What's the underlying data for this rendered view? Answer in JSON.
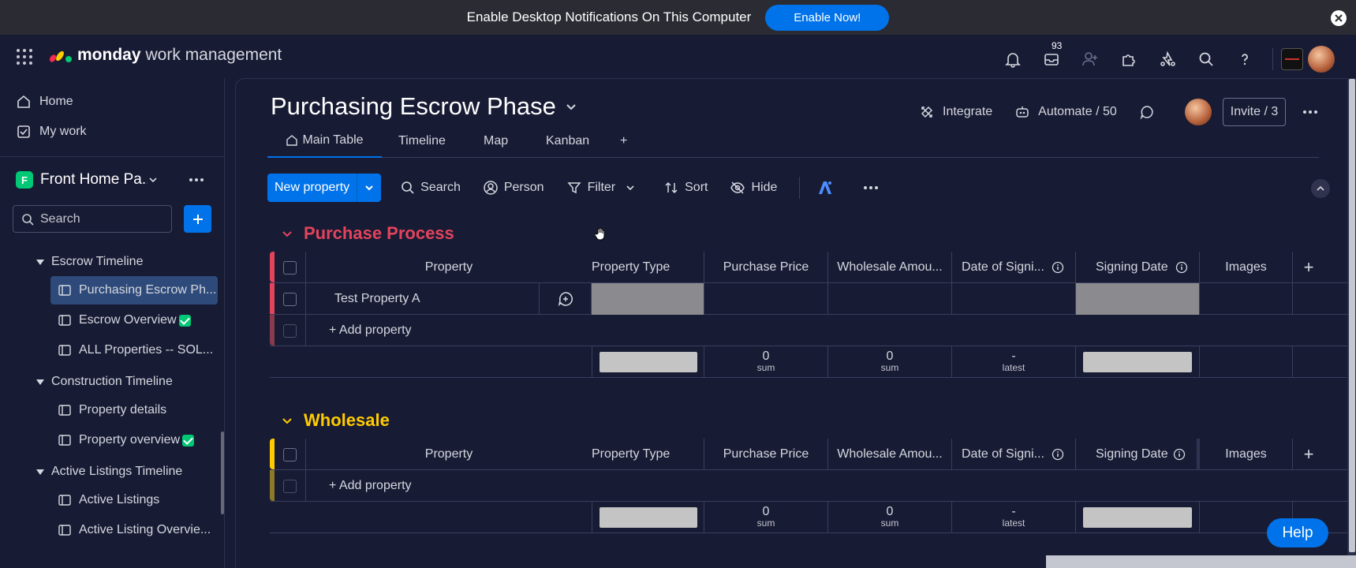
{
  "banner": {
    "text": "Enable Desktop Notifications On This Computer",
    "button": "Enable Now!"
  },
  "topbar": {
    "brand": "monday",
    "product": "work management",
    "inbox_count": "93"
  },
  "sidebar": {
    "home": "Home",
    "my_work": "My work",
    "workspace_initial": "F",
    "workspace_name": "Front Home Pa...",
    "search_placeholder": "Search",
    "folders": [
      {
        "name": "Escrow Timeline",
        "items": [
          "Purchasing Escrow Ph...",
          "Escrow Overview",
          "ALL Properties -- SOL..."
        ]
      },
      {
        "name": "Construction Timeline",
        "items": [
          "Property details",
          "Property overview"
        ]
      },
      {
        "name": "Active Listings Timeline",
        "items": [
          "Active Listings",
          "Active Listing Overvie..."
        ]
      }
    ]
  },
  "board": {
    "title": "Purchasing Escrow Phase",
    "integrate": "Integrate",
    "automate": "Automate / 50",
    "invite": "Invite / 3",
    "tabs": [
      "Main Table",
      "Timeline",
      "Map",
      "Kanban",
      "+"
    ],
    "toolbar": {
      "new": "New property",
      "search": "Search",
      "person": "Person",
      "filter": "Filter",
      "sort": "Sort",
      "hide": "Hide"
    }
  },
  "columns": [
    "Property",
    "Property Type",
    "Purchase Price",
    "Wholesale Amou...",
    "Date of Signi...",
    "Signing Date",
    "Images",
    "+"
  ],
  "groups": [
    {
      "name": "Purchase Process",
      "color": "#e2445c",
      "rows": [
        {
          "name": "Test Property A"
        }
      ],
      "add_label": "+ Add property",
      "summary": {
        "purchase_price": "0",
        "purchase_price_label": "sum",
        "wholesale": "0",
        "wholesale_label": "sum",
        "date": "-",
        "date_label": "latest"
      }
    },
    {
      "name": "Wholesale",
      "color": "#ffcb00",
      "rows": [],
      "add_label": "+ Add property",
      "summary": {
        "purchase_price": "0",
        "purchase_price_label": "sum",
        "wholesale": "0",
        "wholesale_label": "sum",
        "date": "-",
        "date_label": "latest"
      }
    }
  ],
  "help": "Help",
  "colors": {
    "accent": "#0073ea",
    "purchase_group": "#e2445c",
    "wholesale_group": "#ffcb00",
    "status_done": "#00c875"
  }
}
